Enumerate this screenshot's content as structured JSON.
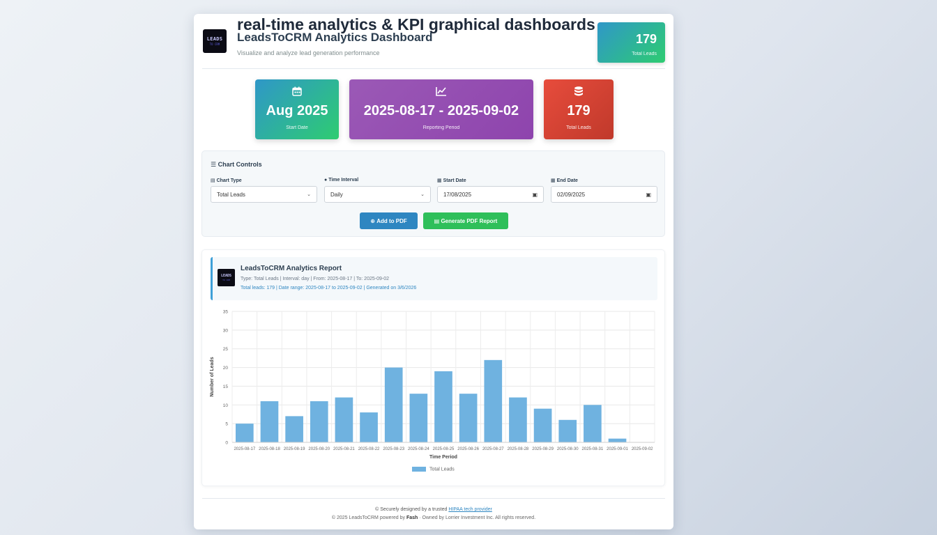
{
  "header": {
    "title": "real-time analytics & KPI graphical dashboards",
    "subtitle": "LeadsToCRM Analytics Dashboard",
    "description": "Visualize and analyze lead generation performance",
    "logo_text": "LEADS",
    "logo_subtext": "TO CRM",
    "badge_value": "179",
    "badge_label": "Total Leads"
  },
  "stats": [
    {
      "icon": "calendar-icon",
      "value": "Aug 2025",
      "caption": "Start Date",
      "color": "#2f97c8"
    },
    {
      "icon": "chart-line-icon",
      "value": "2025-08-17 - 2025-09-02",
      "caption": "Reporting Period",
      "color": "#9b59b6"
    },
    {
      "icon": "database-icon",
      "value": "179",
      "caption": "Total Leads",
      "color": "#e74c3c"
    }
  ],
  "controls": {
    "title": "Chart Controls",
    "chart_type_label": "Chart Type",
    "chart_type_value": "Total Leads",
    "interval_label": "Time Interval",
    "interval_value": "Daily",
    "start_label": "Start Date",
    "start_value": "17/08/2025",
    "end_label": "End Date",
    "end_value": "02/09/2025",
    "add_pdf_label": "Add to PDF",
    "generate_label": "Generate PDF Report"
  },
  "report": {
    "title": "LeadsToCRM Analytics Report",
    "meta_line1": "Type: Total Leads | Interval: day | From: 2025-08-17 | To: 2025-09-02",
    "meta_line2": "Total leads: 179 | Date range: 2025-08-17 to 2025-09-02 | Generated on 3/6/2026"
  },
  "chart_data": {
    "type": "bar",
    "categories": [
      "2025-08-17",
      "2025-08-18",
      "2025-08-19",
      "2025-08-20",
      "2025-08-21",
      "2025-08-22",
      "2025-08-23",
      "2025-08-24",
      "2025-08-25",
      "2025-08-26",
      "2025-08-27",
      "2025-08-28",
      "2025-08-29",
      "2025-08-30",
      "2025-08-31",
      "2025-09-01",
      "2025-09-02"
    ],
    "tick_labels": [
      "2025-08-17",
      "2025-08-18",
      "2025-08-19",
      "2025-08-20",
      "2025-08-21",
      "2025-08-22",
      "2025-08-23",
      "2025-08-24",
      "2025-08-25",
      "2025-08-26",
      "2025-08-27",
      "2025-08-28",
      "2025-08-29",
      "2025-08-30",
      "2025-08-31",
      "2025-09-01",
      "2025-09-02"
    ],
    "series": [
      {
        "name": "Total Leads",
        "values": [
          5,
          11,
          7,
          11,
          12,
          8,
          20,
          13,
          19,
          13,
          22,
          12,
          9,
          6,
          10,
          1,
          0
        ],
        "color": "#6fb2e0"
      }
    ],
    "xlabel": "Time Period",
    "ylabel": "Number of Leads",
    "ylim": [
      0,
      35
    ],
    "yticks": [
      0,
      5,
      10,
      15,
      20,
      25,
      30,
      35
    ],
    "grid": true,
    "legend_position": "bottom"
  },
  "footer": {
    "line1_prefix": "© Securely designed by a trusted ",
    "line1_link": "HIPAA tech provider",
    "line2_prefix": "© 2025 LeadsToCRM powered by ",
    "line2_brand": "Fash",
    "line2_suffix": " · Owned by Lorrier Investment Inc. All rights reserved."
  }
}
